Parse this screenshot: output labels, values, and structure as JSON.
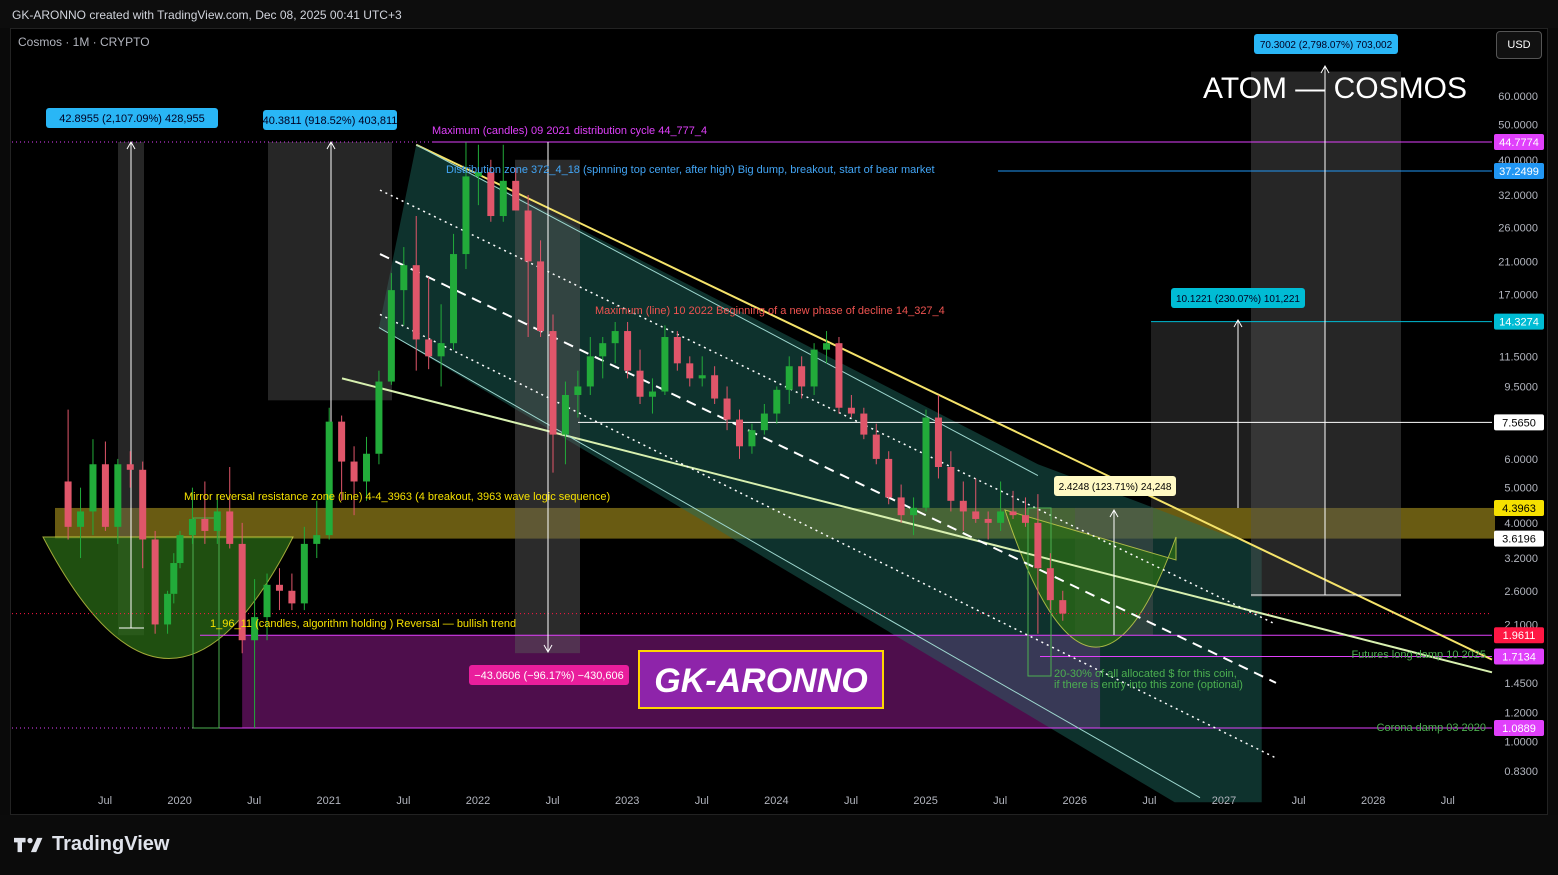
{
  "header": {
    "created_by": "GK-ARONNO created with TradingView.com, Dec 08, 2025 00:41 UTC+3"
  },
  "symbol_info": "Cosmos · 1M · CRYPTO",
  "currency_button": "USD",
  "footer_brand": "TradingView",
  "chart_data": {
    "type": "candlestick",
    "title": "ATOM — COSMOS",
    "watermark": "GK-ARONNO",
    "y_scale": "log",
    "ylim": [
      0.68,
      70.3
    ],
    "y_ticks": [
      "60.0000",
      "50.0000",
      "40.0000",
      "32.0000",
      "26.0000",
      "21.0000",
      "17.0000",
      "11.5000",
      "9.5000",
      "6.0000",
      "5.0000",
      "4.0000",
      "3.2000",
      "2.6000",
      "2.1000",
      "1.4500",
      "1.2000",
      "1.0000",
      "0.8300"
    ],
    "x_ticks": [
      "Jul",
      "2020",
      "Jul",
      "2021",
      "Jul",
      "2022",
      "Jul",
      "2023",
      "Jul",
      "2024",
      "Jul",
      "2025",
      "Jul",
      "2026",
      "Jul",
      "2027",
      "Jul",
      "2028",
      "Jul"
    ],
    "x_range": [
      "2019-04",
      "2028-10"
    ],
    "candles": [
      {
        "t": "2019-04",
        "o": 5.2,
        "h": 8.2,
        "l": 3.6,
        "c": 3.9
      },
      {
        "t": "2019-05",
        "o": 3.9,
        "h": 5.0,
        "l": 3.2,
        "c": 4.3
      },
      {
        "t": "2019-06",
        "o": 4.3,
        "h": 6.8,
        "l": 3.7,
        "c": 5.8
      },
      {
        "t": "2019-07",
        "o": 5.8,
        "h": 6.7,
        "l": 3.8,
        "c": 3.9
      },
      {
        "t": "2019-08",
        "o": 3.9,
        "h": 6.0,
        "l": 3.5,
        "c": 5.8
      },
      {
        "t": "2019-09",
        "o": 5.8,
        "h": 6.3,
        "l": 5.0,
        "c": 5.6
      },
      {
        "t": "2019-10",
        "o": 5.6,
        "h": 5.9,
        "l": 3.0,
        "c": 3.6
      },
      {
        "t": "2019-11",
        "o": 3.6,
        "h": 3.8,
        "l": 1.98,
        "c": 2.1
      },
      {
        "t": "2019-12",
        "o": 2.1,
        "h": 2.6,
        "l": 1.98,
        "c": 2.55
      },
      {
        "t": "2019-12b",
        "o": 2.55,
        "h": 3.3,
        "l": 2.4,
        "c": 3.1
      },
      {
        "t": "2020-01",
        "o": 3.1,
        "h": 3.8,
        "l": 3.0,
        "c": 3.7
      },
      {
        "t": "2020-02",
        "o": 3.7,
        "h": 5.0,
        "l": 3.5,
        "c": 4.1
      },
      {
        "t": "2020-03",
        "o": 4.1,
        "h": 5.2,
        "l": 3.5,
        "c": 3.8
      },
      {
        "t": "2020-04",
        "o": 3.8,
        "h": 4.8,
        "l": 3.5,
        "c": 4.3
      },
      {
        "t": "2020-05",
        "o": 4.3,
        "h": 5.7,
        "l": 3.4,
        "c": 3.5
      },
      {
        "t": "2020-06",
        "o": 3.5,
        "h": 4.0,
        "l": 1.75,
        "c": 1.9
      },
      {
        "t": "2020-07",
        "o": 1.9,
        "h": 2.8,
        "l": 1.09,
        "c": 2.2
      },
      {
        "t": "2020-08",
        "o": 2.2,
        "h": 2.9,
        "l": 1.9,
        "c": 2.7
      },
      {
        "t": "2020-09",
        "o": 2.7,
        "h": 3.0,
        "l": 2.3,
        "c": 2.6
      },
      {
        "t": "2020-10",
        "o": 2.6,
        "h": 2.9,
        "l": 2.3,
        "c": 2.4
      },
      {
        "t": "2020-11",
        "o": 2.4,
        "h": 3.9,
        "l": 2.3,
        "c": 3.5
      },
      {
        "t": "2020-12",
        "o": 3.5,
        "h": 4.6,
        "l": 3.2,
        "c": 3.7
      },
      {
        "t": "2021-01",
        "o": 3.7,
        "h": 8.3,
        "l": 3.6,
        "c": 7.6
      },
      {
        "t": "2021-02",
        "o": 7.6,
        "h": 7.9,
        "l": 4.6,
        "c": 5.9
      },
      {
        "t": "2021-03",
        "o": 5.9,
        "h": 6.5,
        "l": 4.2,
        "c": 5.2
      },
      {
        "t": "2021-04",
        "o": 5.2,
        "h": 6.9,
        "l": 4.6,
        "c": 6.2
      },
      {
        "t": "2021-05",
        "o": 6.2,
        "h": 10.5,
        "l": 5.8,
        "c": 9.8
      },
      {
        "t": "2021-06",
        "o": 9.8,
        "h": 19.5,
        "l": 9.6,
        "c": 17.5
      },
      {
        "t": "2021-07",
        "o": 17.5,
        "h": 23,
        "l": 14,
        "c": 20.5
      },
      {
        "t": "2021-08",
        "o": 20.5,
        "h": 28,
        "l": 10.5,
        "c": 12.8
      },
      {
        "t": "2021-09",
        "o": 12.8,
        "h": 19,
        "l": 10.6,
        "c": 11.5
      },
      {
        "t": "2021-10",
        "o": 11.5,
        "h": 16,
        "l": 9.5,
        "c": 12.5
      },
      {
        "t": "2021-11",
        "o": 12.5,
        "h": 25,
        "l": 12,
        "c": 22
      },
      {
        "t": "2021-12",
        "o": 22,
        "h": 44.7,
        "l": 20,
        "c": 36
      },
      {
        "t": "2022-01",
        "o": 36,
        "h": 44,
        "l": 30,
        "c": 37
      },
      {
        "t": "2022-02",
        "o": 37,
        "h": 40,
        "l": 27,
        "c": 28
      },
      {
        "t": "2022-03",
        "o": 28,
        "h": 44,
        "l": 27,
        "c": 35
      },
      {
        "t": "2022-04",
        "o": 35,
        "h": 38,
        "l": 29,
        "c": 29
      },
      {
        "t": "2022-05",
        "o": 29,
        "h": 32,
        "l": 13,
        "c": 21
      },
      {
        "t": "2022-06",
        "o": 21,
        "h": 24,
        "l": 13,
        "c": 13.5
      },
      {
        "t": "2022-07",
        "o": 13.5,
        "h": 15,
        "l": 5.5,
        "c": 7.0
      },
      {
        "t": "2022-08",
        "o": 7.0,
        "h": 9.8,
        "l": 5.8,
        "c": 9.0
      },
      {
        "t": "2022-09",
        "o": 9.0,
        "h": 10.5,
        "l": 7.8,
        "c": 9.5
      },
      {
        "t": "2022-10",
        "o": 9.5,
        "h": 13,
        "l": 9.0,
        "c": 11.5
      },
      {
        "t": "2022-11",
        "o": 11.5,
        "h": 13,
        "l": 10,
        "c": 12.5
      },
      {
        "t": "2022-12",
        "o": 12.5,
        "h": 14.3,
        "l": 11,
        "c": 13.5
      },
      {
        "t": "2023-01",
        "o": 13.5,
        "h": 14.3,
        "l": 10,
        "c": 10.5
      },
      {
        "t": "2023-02",
        "o": 10.5,
        "h": 12,
        "l": 8.5,
        "c": 8.9
      },
      {
        "t": "2023-03",
        "o": 8.9,
        "h": 10,
        "l": 8.0,
        "c": 9.2
      },
      {
        "t": "2023-04",
        "o": 9.2,
        "h": 14,
        "l": 9.0,
        "c": 13
      },
      {
        "t": "2023-05",
        "o": 13,
        "h": 13.5,
        "l": 10.5,
        "c": 11
      },
      {
        "t": "2023-06",
        "o": 11,
        "h": 11.5,
        "l": 9.5,
        "c": 10
      },
      {
        "t": "2023-07",
        "o": 10,
        "h": 11.5,
        "l": 9.5,
        "c": 10.2
      },
      {
        "t": "2023-08",
        "o": 10.2,
        "h": 10.8,
        "l": 8.5,
        "c": 8.8
      },
      {
        "t": "2023-09",
        "o": 8.8,
        "h": 9.5,
        "l": 7.2,
        "c": 7.7
      },
      {
        "t": "2023-10",
        "o": 7.7,
        "h": 8.2,
        "l": 6.0,
        "c": 6.5
      },
      {
        "t": "2023-11",
        "o": 6.5,
        "h": 7.5,
        "l": 6.2,
        "c": 7.2
      },
      {
        "t": "2023-12",
        "o": 7.2,
        "h": 8.5,
        "l": 7.0,
        "c": 8.0
      },
      {
        "t": "2024-01",
        "o": 8.0,
        "h": 9.5,
        "l": 7.5,
        "c": 9.3
      },
      {
        "t": "2024-02",
        "o": 9.3,
        "h": 11.5,
        "l": 8.5,
        "c": 10.8
      },
      {
        "t": "2024-03",
        "o": 10.8,
        "h": 11.5,
        "l": 8.8,
        "c": 9.5
      },
      {
        "t": "2024-04",
        "o": 9.5,
        "h": 12.5,
        "l": 9.0,
        "c": 12
      },
      {
        "t": "2024-05",
        "o": 12,
        "h": 13.5,
        "l": 11,
        "c": 12.5
      },
      {
        "t": "2024-06",
        "o": 12.5,
        "h": 13,
        "l": 8.0,
        "c": 8.3
      },
      {
        "t": "2024-07",
        "o": 8.3,
        "h": 9.0,
        "l": 7.8,
        "c": 8.0
      },
      {
        "t": "2024-08",
        "o": 8.0,
        "h": 8.3,
        "l": 6.8,
        "c": 7.0
      },
      {
        "t": "2024-09",
        "o": 7.0,
        "h": 7.5,
        "l": 5.8,
        "c": 6.0
      },
      {
        "t": "2024-10",
        "o": 6.0,
        "h": 6.3,
        "l": 4.5,
        "c": 4.7
      },
      {
        "t": "2024-11",
        "o": 4.7,
        "h": 5.1,
        "l": 4.0,
        "c": 4.2
      },
      {
        "t": "2024-12",
        "o": 4.2,
        "h": 4.7,
        "l": 3.7,
        "c": 4.4
      },
      {
        "t": "2025-01",
        "o": 4.4,
        "h": 8.2,
        "l": 4.3,
        "c": 7.8
      },
      {
        "t": "2025-02",
        "o": 7.8,
        "h": 9.0,
        "l": 5.3,
        "c": 5.7
      },
      {
        "t": "2025-03",
        "o": 5.7,
        "h": 6.3,
        "l": 4.3,
        "c": 4.6
      },
      {
        "t": "2025-04",
        "o": 4.6,
        "h": 5.2,
        "l": 3.8,
        "c": 4.3
      },
      {
        "t": "2025-05",
        "o": 4.3,
        "h": 5.3,
        "l": 4.0,
        "c": 4.1
      },
      {
        "t": "2025-06",
        "o": 4.1,
        "h": 4.3,
        "l": 3.6,
        "c": 4.0
      },
      {
        "t": "2025-07",
        "o": 4.0,
        "h": 5.2,
        "l": 3.8,
        "c": 4.3
      },
      {
        "t": "2025-08",
        "o": 4.3,
        "h": 4.9,
        "l": 4.1,
        "c": 4.2
      },
      {
        "t": "2025-09",
        "o": 4.2,
        "h": 4.7,
        "l": 3.9,
        "c": 4.0
      },
      {
        "t": "2025-10",
        "o": 4.0,
        "h": 4.8,
        "l": 1.98,
        "c": 3.0
      },
      {
        "t": "2025-11",
        "o": 3.0,
        "h": 3.3,
        "l": 2.3,
        "c": 2.45
      },
      {
        "t": "2025-12",
        "o": 2.45,
        "h": 2.6,
        "l": 2.15,
        "c": 2.25
      }
    ],
    "price_labels": [
      {
        "value": "44.7774",
        "color": "#e040fb",
        "price": 44.7774
      },
      {
        "value": "37.2499",
        "color": "#2196f3",
        "price": 37.2499
      },
      {
        "value": "14.3274",
        "color": "#00bcd4",
        "price": 14.3274
      },
      {
        "value": "7.5650",
        "color": "#ffffff",
        "price": 7.565
      },
      {
        "value": "4.3963",
        "color": "#f5e000",
        "price": 4.3963
      },
      {
        "value": "3.6196",
        "color": "#ffffff",
        "price": 3.6196
      },
      {
        "value": "1.9611",
        "color": "#ff1744",
        "price": 1.9611
      },
      {
        "value": "1.7134",
        "color": "#e040fb",
        "price": 1.7134
      },
      {
        "value": "1.0889",
        "color": "#e040fb",
        "price": 1.0889
      }
    ],
    "measure_labels": [
      {
        "text": "42.8955 (2,107.09%) 428,955",
        "color": "#29b6f6"
      },
      {
        "text": "40.3811 (918.52%) 403,811",
        "color": "#29b6f6"
      },
      {
        "text": "−43.0606 (−96.17%) −430,606",
        "color": "#e91e9c"
      },
      {
        "text": "70.3002 (2,798.07%) 703,002",
        "color": "#29b6f6"
      },
      {
        "text": "10.1221 (230.07%) 101,221",
        "color": "#00bcd4"
      },
      {
        "text": "2.4248 (123.71%) 24,248",
        "color": "#fff9c4"
      }
    ],
    "annotations": [
      {
        "text": "Maximum (candles) 09 2021 distribution cycle 44_777_4",
        "color": "#e040fb"
      },
      {
        "text": "Distribution zone 372_4_18 (spinning top center, after high) Big dump, breakout, start of bear market",
        "color": "#42a5f5"
      },
      {
        "text": "Maximum (line) 10 2022 Beginning of a new phase of decline 14_327_4",
        "color": "#ef5350"
      },
      {
        "text": "Mirror reversal resistance zone (line) 4-4_3963 (4 breakout, 3963 wave logic sequence)",
        "color": "#f5e000"
      },
      {
        "text": "1_96_11 (candles, algorithm holding ) Reversal — bullish trend",
        "color": "#f5e000"
      },
      {
        "text": "Futures long damp 10 2025",
        "color": "#4caf50"
      },
      {
        "text": "Corona damp 03 2020",
        "color": "#4caf50"
      },
      {
        "text": "20-30% of all allocated $ for this coin,",
        "color": "#4caf50"
      },
      {
        "text": "if there is entry into this zone (optional)",
        "color": "#4caf50"
      }
    ],
    "colors": {
      "up": "#22ab3a",
      "down": "#e0566a",
      "trendline": "#f5e36a",
      "channel": "#2c8c7c"
    }
  }
}
